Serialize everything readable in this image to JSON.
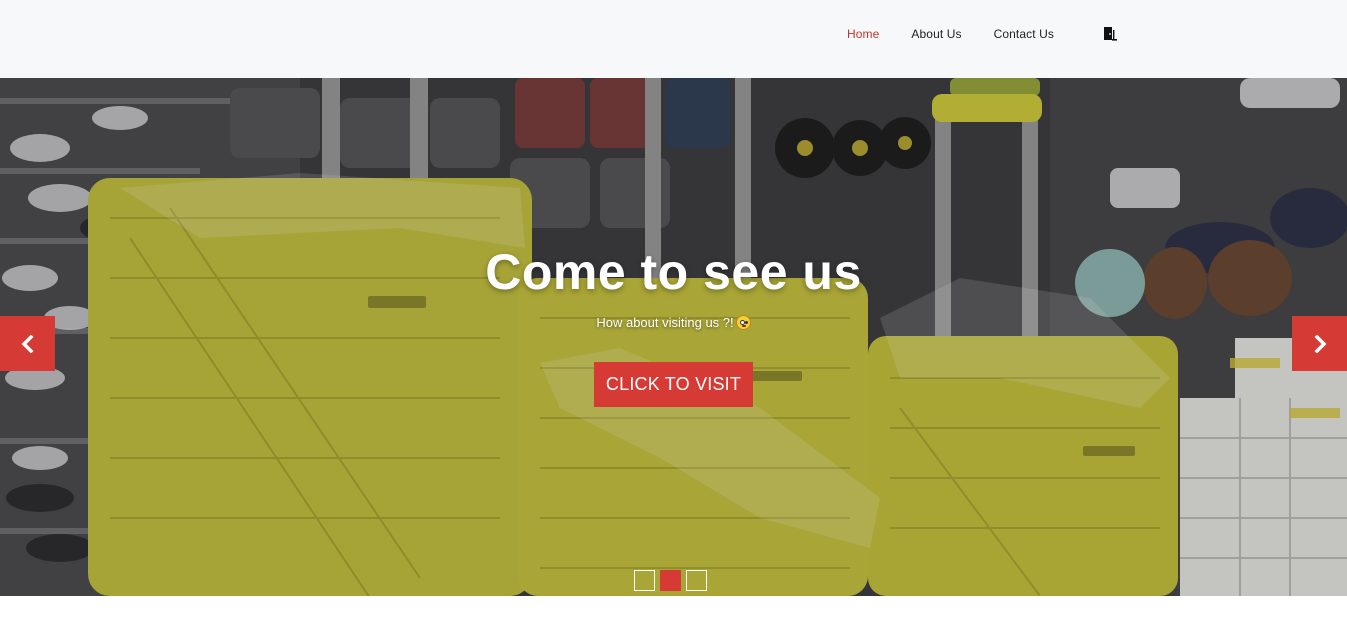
{
  "nav": {
    "items": [
      {
        "label": "Home",
        "active": true
      },
      {
        "label": "About Us",
        "active": false
      },
      {
        "label": "Contact Us",
        "active": false
      }
    ],
    "login_icon": "door-exit-icon"
  },
  "hero": {
    "title": "Come to see us",
    "subtitle": "How about visiting us ?!",
    "subtitle_emoji": "flushed-face-emoji",
    "cta_label": "CLICK TO VISIT",
    "prev_icon": "chevron-left-icon",
    "next_icon": "chevron-right-icon",
    "slide_count": 3,
    "active_slide": 2
  },
  "colors": {
    "accent": "#d63a34",
    "nav_active": "#c8322b",
    "navbar_bg": "#f7f8fa",
    "luggage": "#c9c43a"
  }
}
